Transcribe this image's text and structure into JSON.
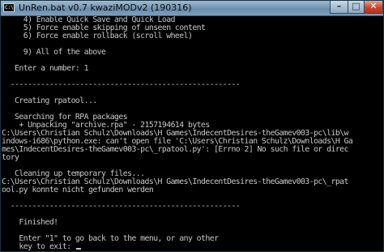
{
  "window": {
    "icon_text": "C:\\",
    "title": "UnRen.bat v0.7 kwaziMODv2 (190316)",
    "minimize_glyph": "–",
    "maximize_glyph": "□",
    "close_glyph": "✕"
  },
  "console": {
    "lines": [
      "     4) Enable Quick Save and Quick Load",
      "     5) Force enable skipping of unseen content",
      "     6) Force enable rollback (scroll wheel)",
      "",
      "     9) All of the above",
      "",
      "   Enter a number: 1",
      "",
      "  -----------------------------------------------------",
      "",
      "   Creating rpatool...",
      "",
      "   Searching for RPA packages",
      "    + Unpacking \"archive.rpa\" - 2157194614 bytes",
      "C:\\Users\\Christian Schulz\\Downloads\\H Games\\IndecentDesires-theGamev003-pc\\lib\\w",
      "indows-i686\\python.exe: can't open file 'C:\\Users\\Christian Schulz\\Downloads\\H Ga",
      "mes\\IndecentDesires-theGamev003-pc\\_rpatool.py': [Errno 2] No such file or direc",
      "tory",
      "",
      "   Cleaning up temporary files...",
      "C:\\Users\\Christian Schulz\\Downloads\\H Games\\IndecentDesires-theGamev003-pc\\_rpat",
      "ool.py konnte nicht gefunden werden",
      "",
      "  -----------------------------------------------------",
      "",
      "    Finished!",
      "",
      "    Enter \"1\" to go back to the menu, or any other",
      "    key to exit: "
    ]
  }
}
